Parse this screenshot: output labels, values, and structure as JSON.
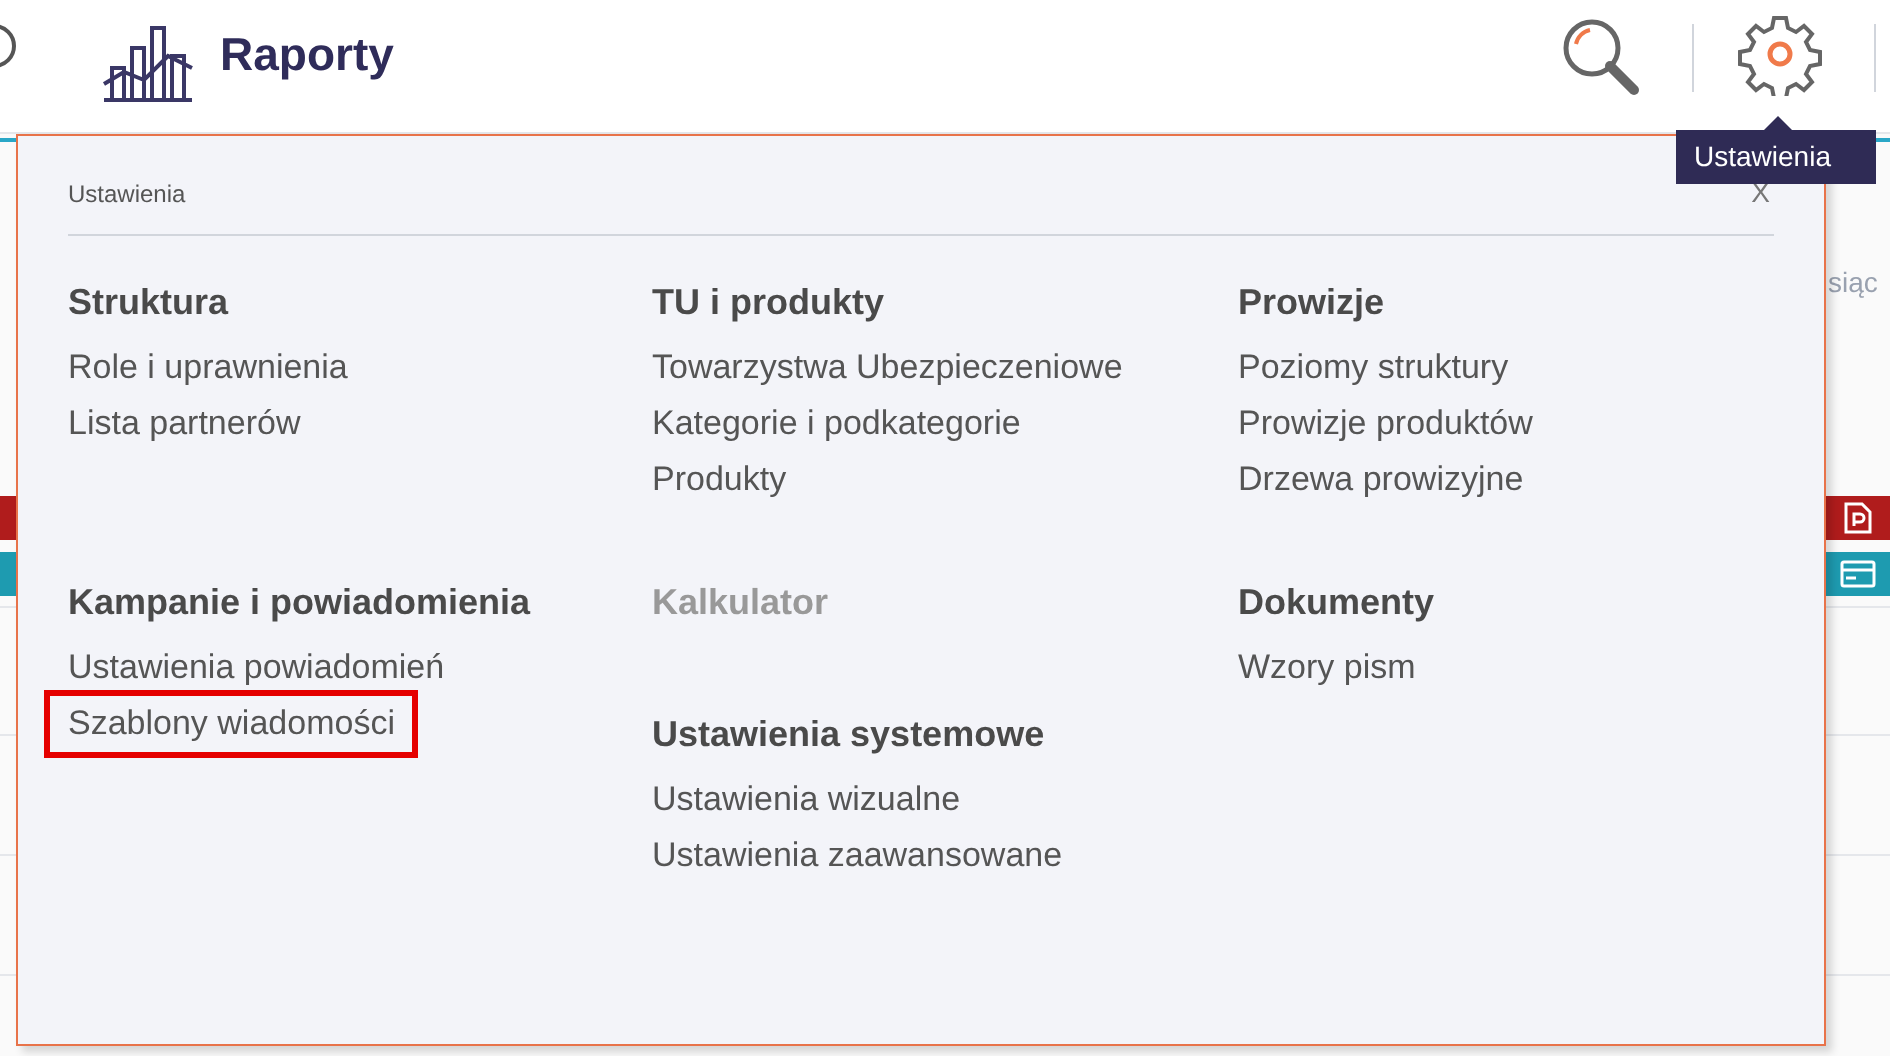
{
  "header": {
    "title": "Raporty",
    "tooltip": "Ustawienia"
  },
  "background": {
    "partial_text": "siąc"
  },
  "settings_panel": {
    "title": "Ustawienia",
    "close": "X",
    "rows": [
      {
        "cells": [
          [
            {
              "heading": "Struktura",
              "disabled": false,
              "items": [
                {
                  "label": "Role i uprawnienia",
                  "highlighted": false
                },
                {
                  "label": "Lista partnerów",
                  "highlighted": false
                }
              ]
            }
          ],
          [
            {
              "heading": "TU i produkty",
              "disabled": false,
              "items": [
                {
                  "label": "Towarzystwa Ubezpieczeniowe",
                  "highlighted": false
                },
                {
                  "label": "Kategorie i podkategorie",
                  "highlighted": false
                },
                {
                  "label": "Produkty",
                  "highlighted": false
                }
              ]
            }
          ],
          [
            {
              "heading": "Prowizje",
              "disabled": false,
              "items": [
                {
                  "label": "Poziomy struktury",
                  "highlighted": false
                },
                {
                  "label": "Prowizje produktów",
                  "highlighted": false
                },
                {
                  "label": "Drzewa prowizyjne",
                  "highlighted": false
                }
              ]
            }
          ]
        ]
      },
      {
        "cells": [
          [
            {
              "heading": "Kampanie i powiadomienia",
              "disabled": false,
              "items": [
                {
                  "label": "Ustawienia powiadomień",
                  "highlighted": false
                },
                {
                  "label": "Szablony wiadomości",
                  "highlighted": true
                }
              ]
            }
          ],
          [
            {
              "heading": "Kalkulator",
              "disabled": true
            },
            {
              "heading": "Ustawienia systemowe",
              "disabled": false,
              "items": [
                {
                  "label": "Ustawienia wizualne",
                  "highlighted": false
                },
                {
                  "label": "Ustawienia zaawansowane",
                  "highlighted": false
                }
              ]
            }
          ],
          [
            {
              "heading": "Dokumenty",
              "disabled": false,
              "items": [
                {
                  "label": "Wzory pism",
                  "highlighted": false
                }
              ]
            }
          ]
        ]
      }
    ]
  }
}
